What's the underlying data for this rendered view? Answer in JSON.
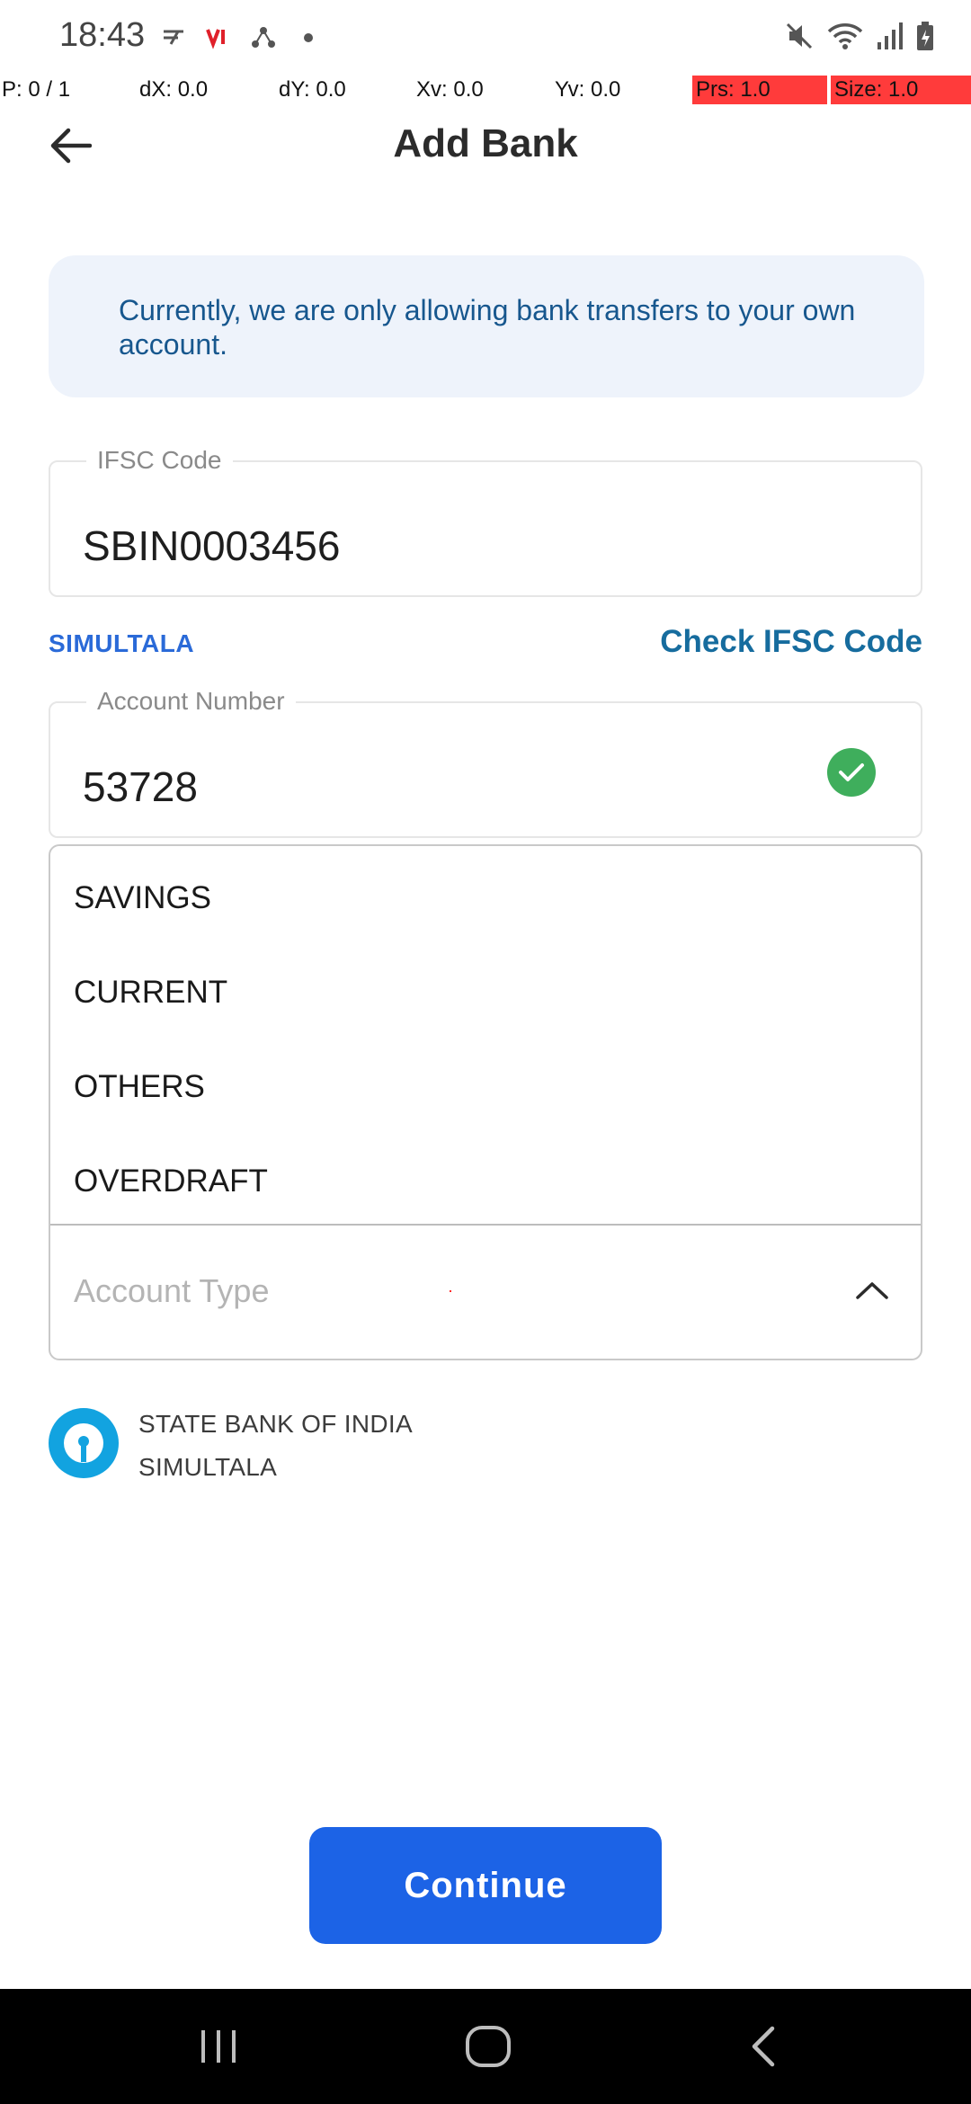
{
  "status_bar": {
    "time": "18:43",
    "icons": [
      "data-saver-icon",
      "vi-carrier-icon",
      "network-share-icon",
      "dot-icon",
      "mute-icon",
      "wifi-icon",
      "signal-icon",
      "battery-icon"
    ]
  },
  "pointer_overlay": {
    "p": "P: 0 / 1",
    "dx": "dX: 0.0",
    "dy": "dY: 0.0",
    "xv": "Xv: 0.0",
    "yv": "Yv: 0.0",
    "prs": "Prs: 1.0",
    "size": "Size: 1.0"
  },
  "header": {
    "title": "Add Bank"
  },
  "info": {
    "message": "Currently, we are only allowing bank transfers to your own account."
  },
  "ifsc": {
    "label": "IFSC Code",
    "value": "SBIN0003456"
  },
  "branch": {
    "short": "SIMULTALA",
    "check_link": "Check IFSC Code"
  },
  "account_number": {
    "label": "Account Number",
    "value": "53728"
  },
  "account_type": {
    "placeholder": "Account Type",
    "options": [
      "SAVINGS",
      "CURRENT",
      "OTHERS",
      "OVERDRAFT"
    ]
  },
  "bank": {
    "name": "STATE BANK OF INDIA",
    "branch": "SIMULTALA"
  },
  "actions": {
    "continue": "Continue"
  },
  "colors": {
    "primary": "#1c63e6",
    "link": "#166c9e",
    "info_bg": "#eef3fb",
    "success": "#3fae5c",
    "sbi_blue": "#12a3e0"
  }
}
